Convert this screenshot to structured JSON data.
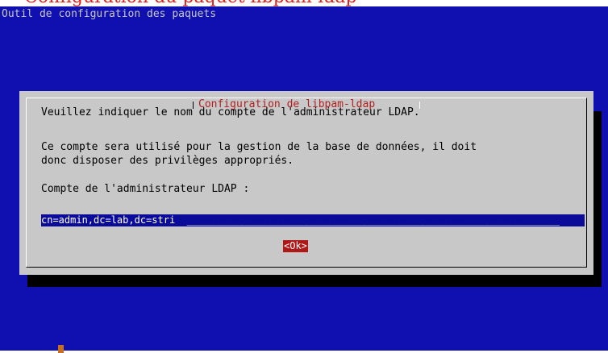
{
  "annotation_text": "Configuration du paquet libpam-ldap",
  "backtitle": "Outil de configuration des paquets",
  "dialog": {
    "title": "Configuration de libpam-ldap",
    "line1": "Veuillez indiquer le nom du compte de l'administrateur LDAP.",
    "line2": "Ce compte sera utilisé pour la gestion de la base de données, il doit",
    "line3": "donc disposer des privilèges appropriés.",
    "prompt": "Compte de l'administrateur LDAP :",
    "input_value": "cn=admin,dc=lab,dc=stri",
    "input_padding": "                         ________________________________________________________________",
    "ok_label": "<Ok>"
  },
  "colors": {
    "screen_bg": "#1010b0",
    "dialog_bg": "#c8c8c8",
    "title": "#b02020",
    "input_bg": "#0b0b9a",
    "ok_bg": "#b01818",
    "annotation": "#e0201a"
  }
}
